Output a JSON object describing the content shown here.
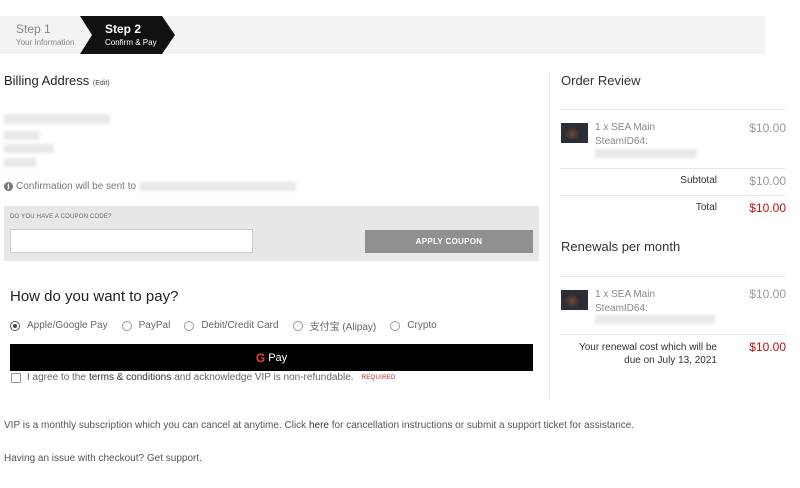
{
  "steps": [
    {
      "title": "Step 1",
      "subtitle": "Your Information"
    },
    {
      "title": "Step 2",
      "subtitle": "Confirm & Pay"
    }
  ],
  "billing": {
    "title": "Billing Address",
    "edit_label": "(Edit)",
    "confirmation_prefix": "Confirmation will be sent to"
  },
  "coupon": {
    "label": "DO YOU HAVE A COUPON CODE?",
    "input_value": "",
    "button_label": "APPLY COUPON"
  },
  "payment": {
    "title": "How do you want to pay?",
    "methods": [
      "Apple/Google Pay",
      "PayPal",
      "Debit/Credit Card",
      "支付宝 (Alipay)",
      "Crypto"
    ],
    "selected": "Apple/Google Pay",
    "gpay_g": "G",
    "gpay_label": "Pay"
  },
  "agreement": {
    "prefix": "I agree to the",
    "link": "terms & conditions",
    "suffix": "and acknowledge VIP is non-refundable.",
    "required": "REQUIRED"
  },
  "order_review": {
    "title": "Order Review",
    "item_name": "1 x SEA Main",
    "item_id_label": "SteamID64:",
    "item_price": "$10.00",
    "subtotal_label": "Subtotal",
    "subtotal": "$10.00",
    "total_label": "Total",
    "total": "$10.00"
  },
  "renewals": {
    "title": "Renewals per month",
    "item_name": "1 x SEA Main",
    "item_id_label": "SteamID64:",
    "item_price": "$10.00",
    "note": "Your renewal cost which will be due on July 13, 2021",
    "cost": "$10.00"
  },
  "footer": {
    "line1_a": "VIP is a monthly subscription which you can cancel at anytime. Click",
    "line1_here": "here",
    "line1_b": "for cancellation instructions or submit a support ticket for assistance.",
    "line2": "Having an issue with checkout? Get support."
  },
  "colors": {
    "accent_dark": "#111111",
    "total_red": "#b11111",
    "button_gray": "#909090"
  },
  "icons": [
    "info-icon",
    "google-g-icon",
    "game-thumbnail"
  ]
}
